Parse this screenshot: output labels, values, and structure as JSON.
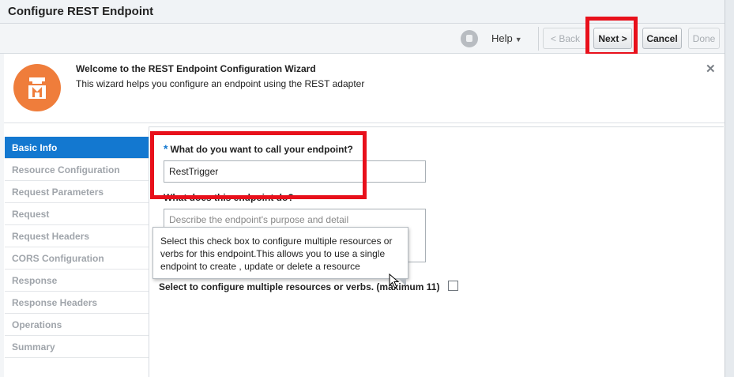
{
  "window": {
    "title": "Configure REST Endpoint"
  },
  "toolbar": {
    "help_label": "Help",
    "back_label": "< Back",
    "next_label": "Next >",
    "cancel_label": "Cancel",
    "done_label": "Done"
  },
  "welcome": {
    "title": "Welcome to the REST Endpoint Configuration Wizard",
    "subtitle": "This wizard helps you configure an endpoint using the REST adapter"
  },
  "nav": {
    "items": [
      {
        "label": "Basic Info",
        "active": true
      },
      {
        "label": "Resource Configuration",
        "active": false
      },
      {
        "label": "Request Parameters",
        "active": false
      },
      {
        "label": "Request",
        "active": false
      },
      {
        "label": "Request Headers",
        "active": false
      },
      {
        "label": "CORS Configuration",
        "active": false
      },
      {
        "label": "Response",
        "active": false
      },
      {
        "label": "Response Headers",
        "active": false
      },
      {
        "label": "Operations",
        "active": false
      },
      {
        "label": "Summary",
        "active": false
      }
    ]
  },
  "form": {
    "required_mark": "*",
    "name_label": "What do you want to call your endpoint?",
    "name_value": "RestTrigger",
    "desc_label": "What does this endpoint do?",
    "desc_placeholder": "Describe the endpoint's purpose and detail",
    "multi_label": "Select to configure multiple resources or verbs. (maximum 11)",
    "multi_checked": false
  },
  "tooltip": {
    "text": "Select this check box to configure multiple resources or verbs for this endpoint.This allows you to use a single endpoint to create , update or delete a resource"
  },
  "colors": {
    "accent": "#1378d0",
    "highlight": "#e8101b",
    "brand": "#ef7d3b"
  },
  "icons": {
    "help": "help-avatar-icon",
    "close": "close-icon",
    "logo": "wizard-logo-icon"
  }
}
